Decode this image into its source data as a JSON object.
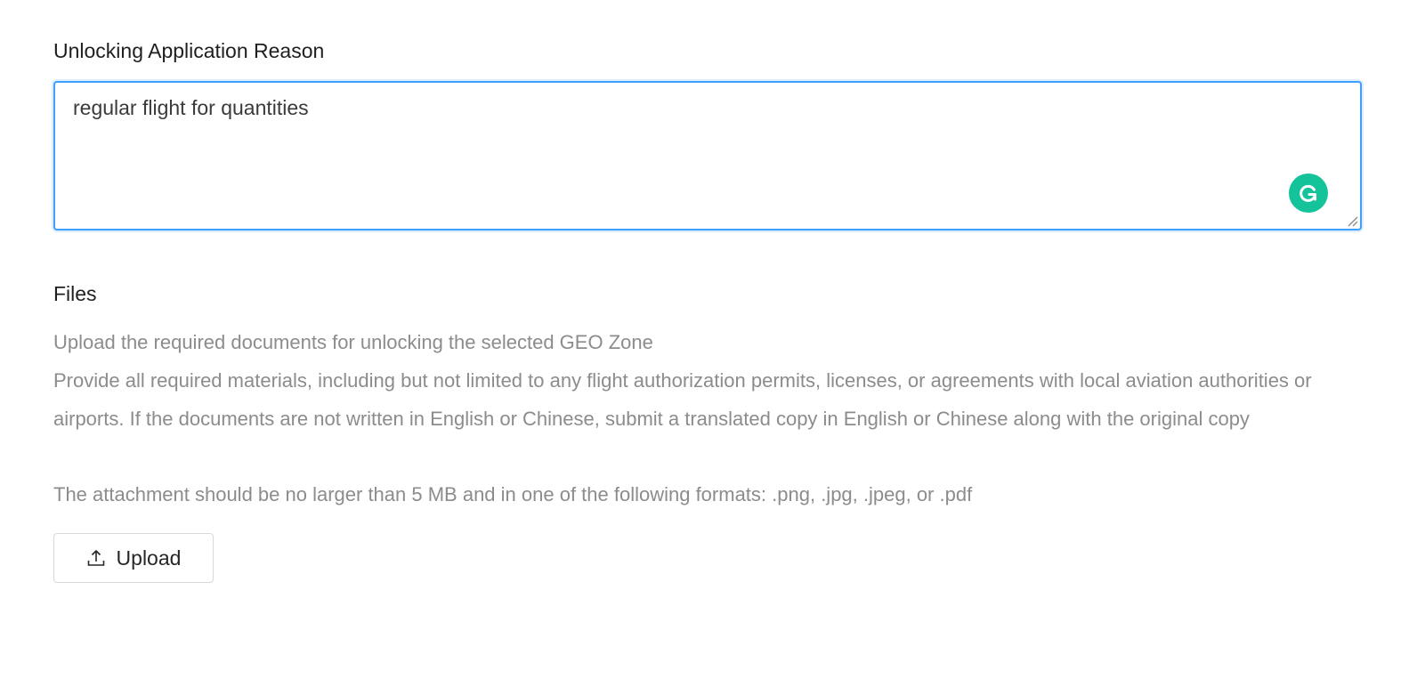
{
  "reason": {
    "label": "Unlocking Application Reason",
    "value": "regular flight for quantities",
    "grammar_icon": "grammarly-icon"
  },
  "files": {
    "label": "Files",
    "hint_title": "Upload the required documents for unlocking the selected GEO Zone",
    "hint_materials": "Provide all required materials, including but not limited to any flight authorization permits, licenses, or agreements with local aviation authorities or airports. If the documents are not written in English or Chinese, submit a translated copy in English or Chinese along with the original copy",
    "hint_limits": "The attachment should be no larger than 5 MB and in one of the following formats: .png, .jpg, .jpeg, or .pdf",
    "upload_label": "Upload",
    "upload_icon": "upload-icon"
  },
  "colors": {
    "focus_border": "#40a0ff",
    "grammar_badge": "#15c39a",
    "hint_text": "#8c8c8c"
  }
}
